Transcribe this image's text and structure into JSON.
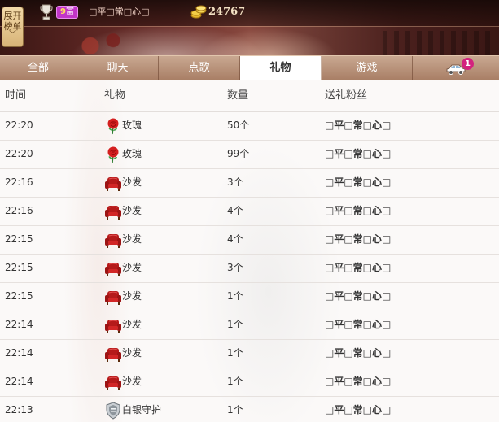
{
  "header": {
    "expand_label_line1": "展开",
    "expand_label_line2": "榜单",
    "rank_prefix": "9",
    "rank_suffix": "富",
    "user_name": "□平□常□心□",
    "coins": "24767"
  },
  "tabs": [
    {
      "label": "全部",
      "active": false
    },
    {
      "label": "聊天",
      "active": false
    },
    {
      "label": "点歌",
      "active": false
    },
    {
      "label": "礼物",
      "active": true
    },
    {
      "label": "游戏",
      "active": false
    }
  ],
  "car_badge": "1",
  "table": {
    "columns": [
      "时间",
      "礼物",
      "数量",
      "送礼粉丝"
    ],
    "rows": [
      {
        "time": "22:20",
        "gift": "玫瑰",
        "icon": "rose-icon",
        "qty": "50个",
        "fan": "□平□常□心□"
      },
      {
        "time": "22:20",
        "gift": "玫瑰",
        "icon": "rose-icon",
        "qty": "99个",
        "fan": "□平□常□心□"
      },
      {
        "time": "22:16",
        "gift": "沙发",
        "icon": "sofa-icon",
        "qty": "3个",
        "fan": "□平□常□心□"
      },
      {
        "time": "22:16",
        "gift": "沙发",
        "icon": "sofa-icon",
        "qty": "4个",
        "fan": "□平□常□心□"
      },
      {
        "time": "22:15",
        "gift": "沙发",
        "icon": "sofa-icon",
        "qty": "4个",
        "fan": "□平□常□心□"
      },
      {
        "time": "22:15",
        "gift": "沙发",
        "icon": "sofa-icon",
        "qty": "3个",
        "fan": "□平□常□心□"
      },
      {
        "time": "22:15",
        "gift": "沙发",
        "icon": "sofa-icon",
        "qty": "1个",
        "fan": "□平□常□心□"
      },
      {
        "time": "22:14",
        "gift": "沙发",
        "icon": "sofa-icon",
        "qty": "1个",
        "fan": "□平□常□心□"
      },
      {
        "time": "22:14",
        "gift": "沙发",
        "icon": "sofa-icon",
        "qty": "1个",
        "fan": "□平□常□心□"
      },
      {
        "time": "22:14",
        "gift": "沙发",
        "icon": "sofa-icon",
        "qty": "1个",
        "fan": "□平□常□心□"
      },
      {
        "time": "22:13",
        "gift": "白银守护",
        "icon": "silver-guard-icon",
        "qty": "1个",
        "fan": "□平□常□心□"
      }
    ]
  },
  "colors": {
    "active_tab_bg": "#ffffff",
    "tab_bar": "#b8907a",
    "rank_badge": "#c236c8",
    "notification_badge": "#d3227e"
  }
}
